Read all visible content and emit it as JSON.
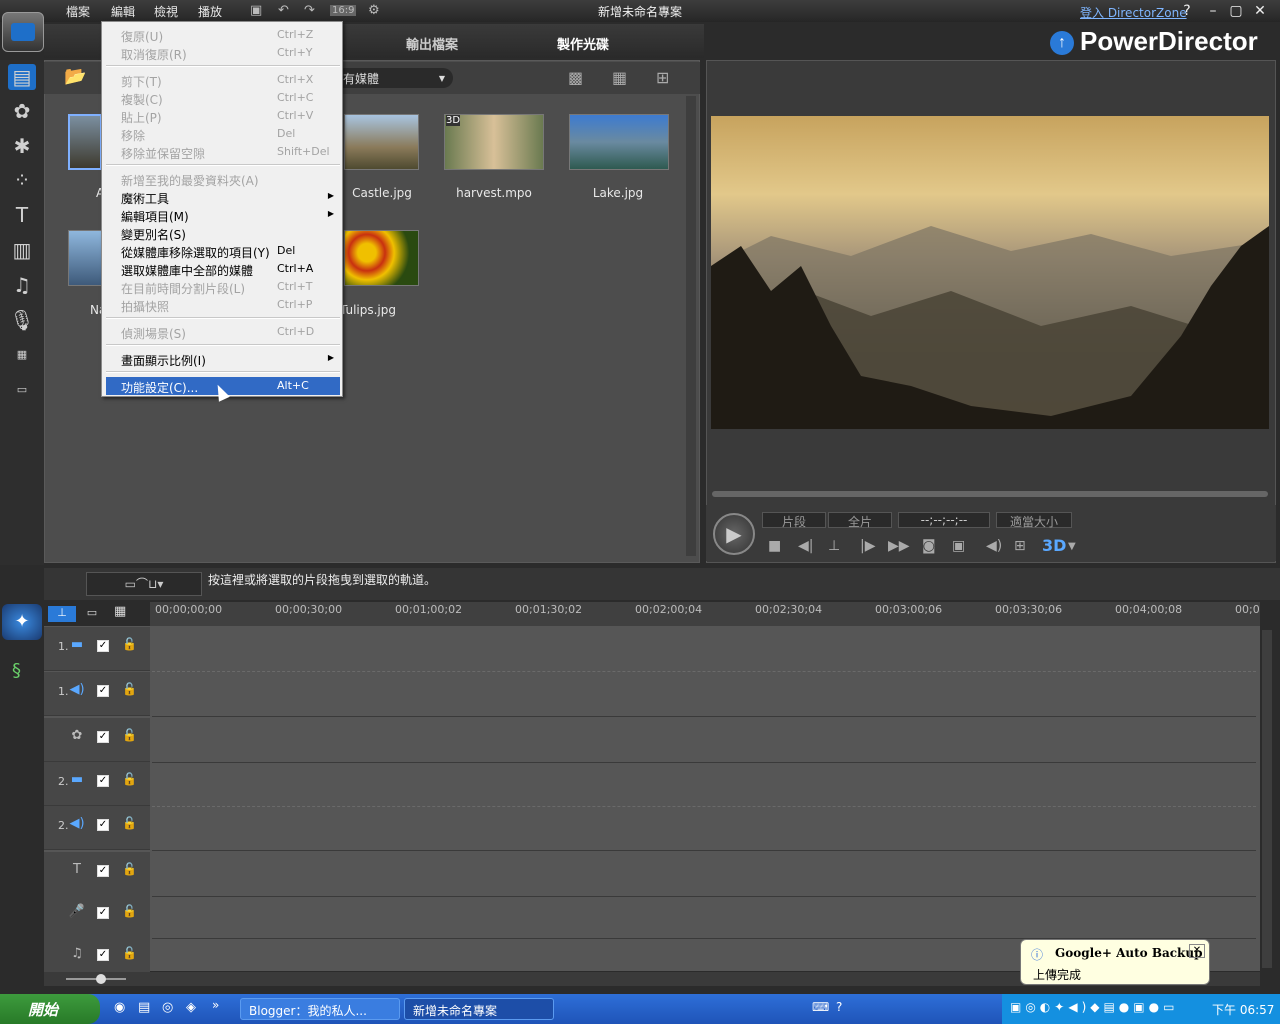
{
  "menubar": {
    "file": "檔案",
    "edit": "編輯",
    "view": "檢視",
    "play": "播放",
    "ratio": "16:9"
  },
  "window_title": "新增未命名專案",
  "directorzone_link": "登入 DirectorZone",
  "window_buttons": {
    "help": "?",
    "min": "–",
    "max": "▢",
    "close": "✕"
  },
  "modes": {
    "output": "輸出檔案",
    "disc": "製作光碟"
  },
  "brand": "PowerDirector",
  "library": {
    "filter_label": "有媒體",
    "items": [
      {
        "label": "Castle.jpg"
      },
      {
        "label": "harvest.mpo",
        "badge": "3D"
      },
      {
        "label": "Lake.jpg"
      },
      {
        "label": "Tulips.jpg"
      },
      {
        "label": "A"
      },
      {
        "label": "Na"
      }
    ]
  },
  "player": {
    "clip": "片段",
    "movie": "全片",
    "timecode": "--;--;--;--",
    "fit": "適當大小",
    "threed": "3D"
  },
  "timeline": {
    "hint": "按這裡或將選取的片段拖曳到選取的軌道。",
    "ruler": [
      "00;00;00;00",
      "00;00;30;00",
      "00;01;00;02",
      "00;01;30;02",
      "00;02;00;04",
      "00;02;30;04",
      "00;03;00;06",
      "00;03;30;06",
      "00;04;00;08",
      "00;0"
    ],
    "tracks": [
      {
        "num": "1.",
        "icon": "video-track-icon",
        "glyph": "▬"
      },
      {
        "num": "1.",
        "icon": "audio-track-icon",
        "glyph": "◀)"
      },
      {
        "num": "",
        "icon": "effect-track-icon",
        "glyph": "✿"
      },
      {
        "num": "2.",
        "icon": "video-track-icon",
        "glyph": "▬"
      },
      {
        "num": "2.",
        "icon": "audio-track-icon",
        "glyph": "◀)"
      },
      {
        "num": "",
        "icon": "title-track-icon",
        "glyph": "T"
      },
      {
        "num": "",
        "icon": "voice-track-icon",
        "glyph": "🎤"
      },
      {
        "num": "",
        "icon": "music-track-icon",
        "glyph": "♫"
      }
    ]
  },
  "edit_menu": [
    {
      "label": "復原(U)",
      "shortcut": "Ctrl+Z",
      "enabled": false
    },
    {
      "label": "取消復原(R)",
      "shortcut": "Ctrl+Y",
      "enabled": false
    },
    {
      "sep": true
    },
    {
      "label": "剪下(T)",
      "shortcut": "Ctrl+X",
      "enabled": false
    },
    {
      "label": "複製(C)",
      "shortcut": "Ctrl+C",
      "enabled": false
    },
    {
      "label": "貼上(P)",
      "shortcut": "Ctrl+V",
      "enabled": false
    },
    {
      "label": "移除",
      "shortcut": "Del",
      "enabled": false
    },
    {
      "label": "移除並保留空隙",
      "shortcut": "Shift+Del",
      "enabled": false
    },
    {
      "sep": true
    },
    {
      "label": "新增至我的最愛資料夾(A)",
      "shortcut": "",
      "enabled": false
    },
    {
      "label": "魔術工具",
      "shortcut": "",
      "enabled": true,
      "submenu": true
    },
    {
      "label": "編輯項目(M)",
      "shortcut": "",
      "enabled": true,
      "submenu": true
    },
    {
      "label": "變更別名(S)",
      "shortcut": "",
      "enabled": true
    },
    {
      "label": "從媒體庫移除選取的項目(Y)",
      "shortcut": "Del",
      "enabled": true
    },
    {
      "label": "選取媒體庫中全部的媒體",
      "shortcut": "Ctrl+A",
      "enabled": true
    },
    {
      "label": "在目前時間分割片段(L)",
      "shortcut": "Ctrl+T",
      "enabled": false
    },
    {
      "label": "拍攝快照",
      "shortcut": "Ctrl+P",
      "enabled": false
    },
    {
      "sep": true
    },
    {
      "label": "偵測場景(S)",
      "shortcut": "Ctrl+D",
      "enabled": false
    },
    {
      "sep": true
    },
    {
      "label": "畫面顯示比例(I)",
      "shortcut": "",
      "enabled": true,
      "submenu": true
    },
    {
      "sep": true
    },
    {
      "label": "功能設定(C)...",
      "shortcut": "Alt+C",
      "enabled": true,
      "highlighted": true
    }
  ],
  "taskbar": {
    "start": "開始",
    "items": [
      {
        "label": "Blogger：我的私人..."
      },
      {
        "label": "新增未命名專案"
      }
    ],
    "clock": "下午 06:57"
  },
  "balloon": {
    "title": "Google+ Auto Backup",
    "body": "上傳完成"
  }
}
